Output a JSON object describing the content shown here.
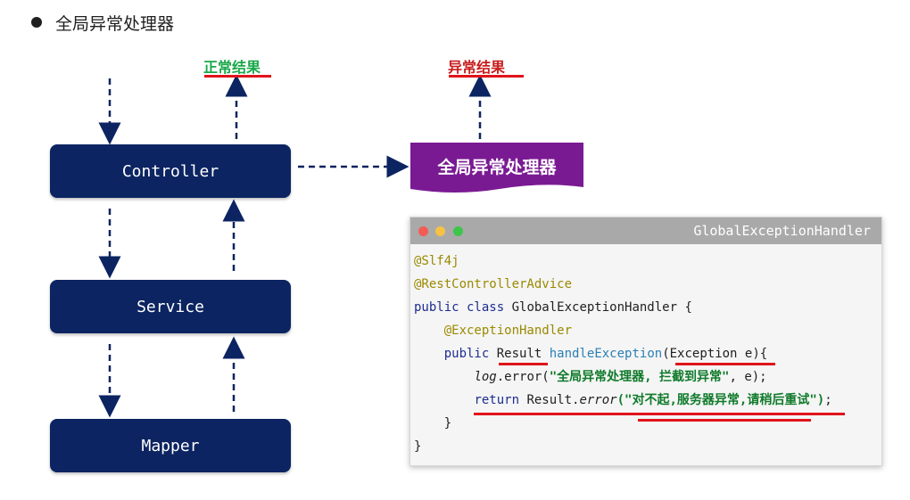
{
  "heading": "全局异常处理器",
  "layers": {
    "controller": "Controller",
    "service": "Service",
    "mapper": "Mapper"
  },
  "labels": {
    "normal_result": "正常结果",
    "exception_result": "异常结果"
  },
  "handler_banner": "全局异常处理器",
  "code_window": {
    "title": "GlobalExceptionHandler",
    "line1": "@Slf4j",
    "line2": "@RestControllerAdvice",
    "line3_kw": "public class",
    "line3_name": " GlobalExceptionHandler {",
    "line4": "@ExceptionHandler",
    "line5_kw": "public",
    "line5_type": "Result",
    "line5_method": "handleException",
    "line5_params": "(Exception e){",
    "line6_obj": "log",
    "line6_call": ".error(",
    "line6_str": "\"全局异常处理器, 拦截到异常\"",
    "line6_end": ", e);",
    "line7_kw": "return",
    "line7_obj": " Result.",
    "line7_method": "error",
    "line7_str": "(\"对不起,服务器异常,请稍后重试\")",
    "line7_end": ";",
    "line8": "}",
    "line9": "}"
  },
  "colors": {
    "layer_box": "#0c2461",
    "banner": "#7a1a93",
    "normal": "#1aa84a",
    "exception": "#c81e1e",
    "underline": "#e0141a"
  }
}
